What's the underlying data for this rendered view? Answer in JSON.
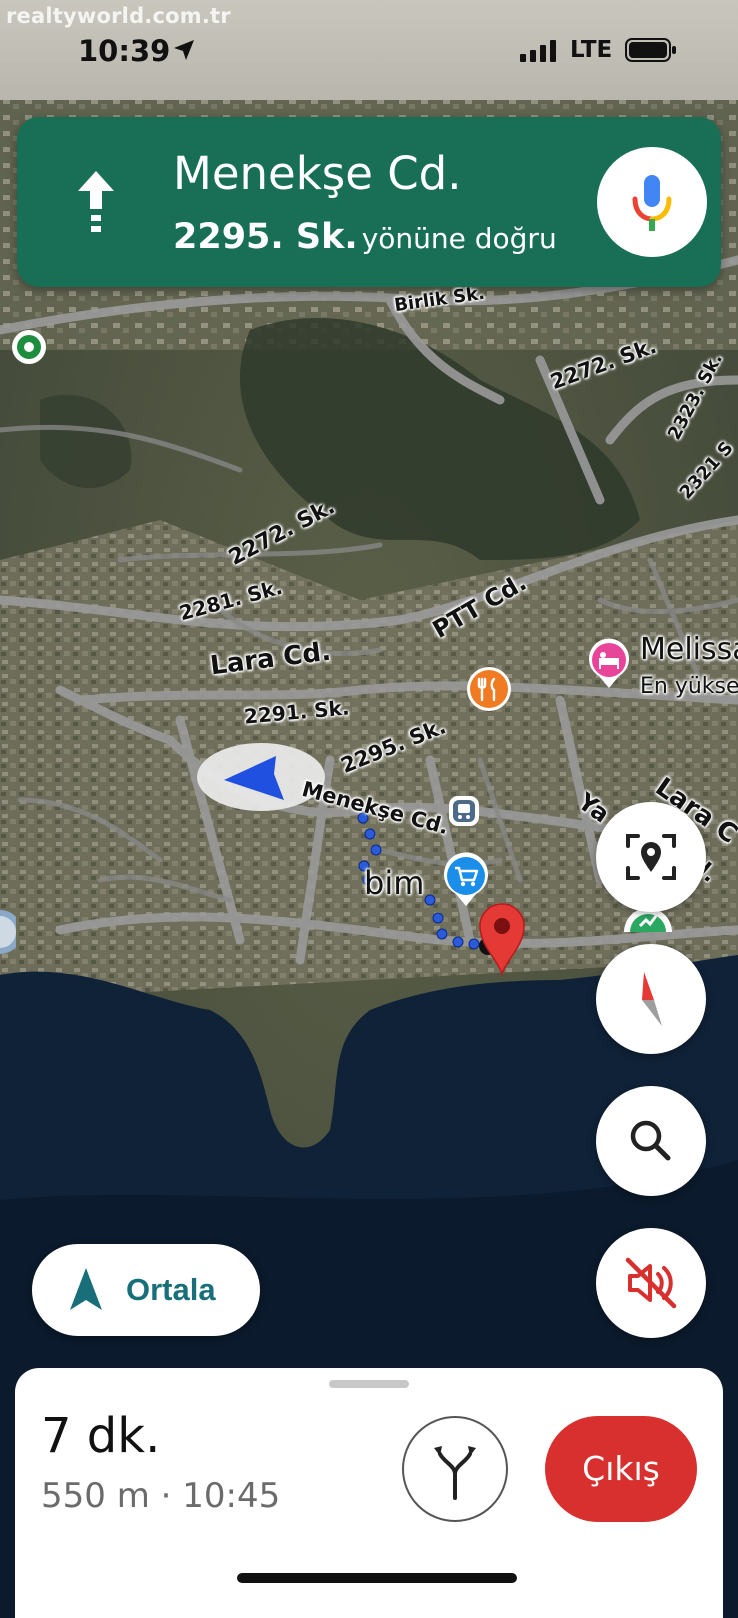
{
  "status_bar": {
    "watermark": "realtyworld.com.tr",
    "time": "10:39",
    "network": "LTE",
    "icons": [
      "location-arrow-icon",
      "signal-bars-icon",
      "battery-icon"
    ]
  },
  "nav_banner": {
    "street": "Menekşe Cd.",
    "toward_street": "2295. Sk.",
    "toward_suffix": "yönüne doğru",
    "maneuver_icon": "straight-arrow-icon",
    "color": "#186f56"
  },
  "map": {
    "labels": {
      "birlik": "Birlik Sk.",
      "s2272a": "2272. Sk.",
      "s2323": "2323. Sk.",
      "s2321": "2321 S",
      "s2272b": "2272. Sk.",
      "s2281": "2281. Sk.",
      "ptt": "PTT Cd.",
      "lara": "Lara Cd.",
      "s2291": "2291. Sk.",
      "s2295": "2295. Sk.",
      "menekse": "Menekşe Cd.",
      "lara2": "Lara C",
      "ya": "Ya",
      "d": "d.",
      "bim": "bim",
      "melissa": "Melissa",
      "melissa_sub": "En yükse"
    },
    "poi_icons": [
      "place-marker-icon",
      "restaurant-icon",
      "hotel-icon",
      "bus-stop-icon",
      "shopping-cart-icon",
      "destination-pin-icon",
      "navigation-arrow-icon"
    ]
  },
  "controls": {
    "recenter_label": "Ortala",
    "buttons": [
      "lens-icon",
      "compass-icon",
      "search-icon",
      "mute-icon"
    ]
  },
  "bottom_sheet": {
    "duration": "7 dk.",
    "distance": "550 m",
    "separator": "·",
    "arrival": "10:45",
    "exit_label": "Çıkış",
    "exit_color": "#d8302e"
  }
}
